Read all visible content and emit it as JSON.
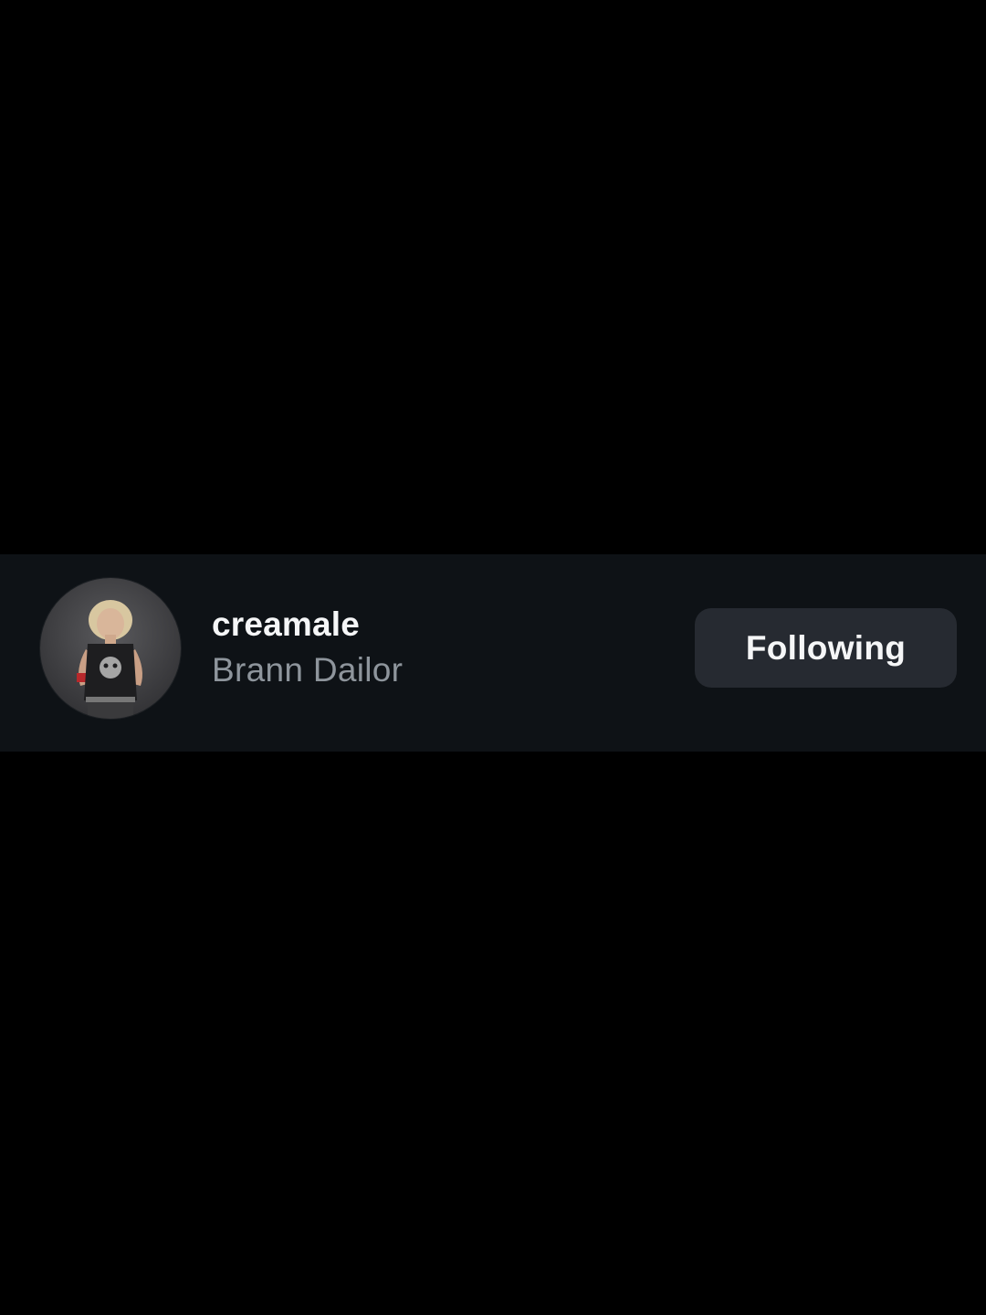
{
  "user_row": {
    "username": "creamale",
    "full_name": "Brann Dailor",
    "avatar_icon": "profile-photo",
    "follow_button_label": "Following"
  },
  "colors": {
    "background": "#000000",
    "row_background": "#0e1216",
    "button_background": "#262a31",
    "primary_text": "#f5f6f7",
    "secondary_text": "#8e959c"
  }
}
